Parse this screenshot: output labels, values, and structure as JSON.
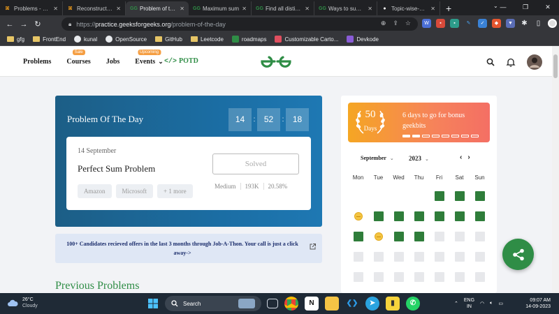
{
  "browser": {
    "tabs": [
      {
        "title": "Problems - Leetcode",
        "favicon": "leetcode-icon",
        "active": false
      },
      {
        "title": "Reconstruct Itinerary",
        "favicon": "leetcode-icon",
        "active": false
      },
      {
        "title": "Problem of the Day",
        "favicon": "gfg-icon",
        "active": true
      },
      {
        "title": "Maximum sum",
        "favicon": "gfg-icon",
        "active": false
      },
      {
        "title": "Find all distinct",
        "favicon": "gfg-icon",
        "active": false
      },
      {
        "title": "Ways to sum to N",
        "favicon": "gfg-icon",
        "active": false
      },
      {
        "title": "Topic-wise-practice",
        "favicon": "github-icon",
        "active": false
      }
    ],
    "url_scheme": "https://",
    "url_host": "practice.geeksforgeeks.org",
    "url_path": "/problem-of-the-day",
    "bookmarks": [
      {
        "label": "gfg",
        "type": "folder"
      },
      {
        "label": "FrontEnd",
        "type": "folder"
      },
      {
        "label": "kunal",
        "type": "github"
      },
      {
        "label": "OpenSource",
        "type": "github"
      },
      {
        "label": "GitHub",
        "type": "folder"
      },
      {
        "label": "Leetcode",
        "type": "folder"
      },
      {
        "label": "roadmaps",
        "type": "site"
      },
      {
        "label": "Customizable Carto...",
        "type": "site"
      },
      {
        "label": "Devkode",
        "type": "site"
      }
    ]
  },
  "header": {
    "nav": [
      {
        "label": "Problems",
        "badge": ""
      },
      {
        "label": "Courses",
        "badge": "Sale"
      },
      {
        "label": "Jobs",
        "badge": ""
      },
      {
        "label": "Events",
        "badge": "Upcoming"
      }
    ],
    "potd_label": "POTD"
  },
  "potd": {
    "title": "Problem Of The Day",
    "timer": {
      "hours": "14",
      "minutes": "52",
      "seconds": "18"
    },
    "date": "14 September",
    "problem_name": "Perfect Sum Problem",
    "tags": [
      "Amazon",
      "Microsoft",
      "+ 1 more"
    ],
    "status_button": "Solved",
    "difficulty": "Medium",
    "submissions": "193K",
    "accuracy": "20.58%"
  },
  "banner": {
    "text": "100+ Candidates recieved offers in the last 3 months through Job-A-Thon. Your call is just a click away->"
  },
  "previous_heading": "Previous Problems",
  "bonus": {
    "streak_number": "50",
    "streak_unit": "Days",
    "message": "6 days to go for bonus geekbits",
    "progress_filled": 2,
    "progress_total": 8
  },
  "calendar": {
    "month": "September",
    "year": "2023",
    "weekdays": [
      "Mon",
      "Tue",
      "Wed",
      "Thu",
      "Fri",
      "Sat",
      "Sun"
    ],
    "rows": [
      [
        "",
        "",
        "",
        "",
        "done",
        "done",
        "done"
      ],
      [
        "coin",
        "done",
        "done",
        "done",
        "done",
        "done",
        "done"
      ],
      [
        "done",
        "coin",
        "done",
        "done",
        "empty",
        "empty",
        "empty"
      ],
      [
        "empty",
        "empty",
        "empty",
        "empty",
        "empty",
        "empty",
        "empty"
      ],
      [
        "empty",
        "empty",
        "empty",
        "empty",
        "empty",
        "empty",
        "empty"
      ]
    ]
  },
  "taskbar": {
    "temperature": "26°C",
    "weather": "Cloudy",
    "search_label": "Search",
    "lang_top": "ENG",
    "lang_bottom": "IN",
    "time": "09:07 AM",
    "date": "14-09-2023"
  },
  "colors": {
    "gfg_green": "#2f8d46",
    "potd_blue": "#1b6da3",
    "bonus_orange": "#f5a623",
    "done_green": "#2f7d3a"
  }
}
